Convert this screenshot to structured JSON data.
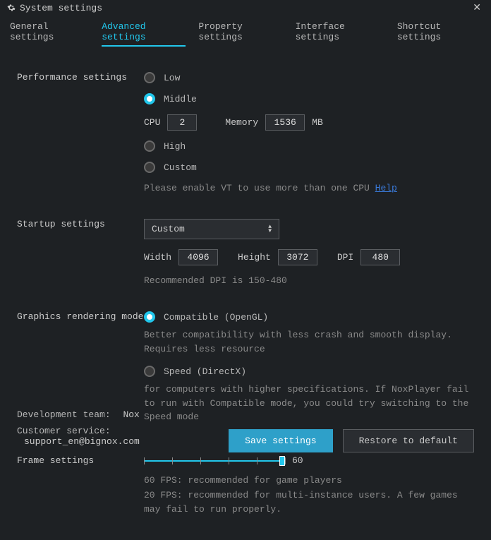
{
  "titlebar": {
    "title": "System settings"
  },
  "tabs": {
    "general": "General settings",
    "advanced": "Advanced settings",
    "property": "Property settings",
    "interface": "Interface settings",
    "shortcut": "Shortcut settings"
  },
  "perf": {
    "label": "Performance settings",
    "low": "Low",
    "middle": "Middle",
    "high": "High",
    "custom": "Custom",
    "cpu_label": "CPU",
    "cpu_value": "2",
    "mem_label": "Memory",
    "mem_value": "1536",
    "mem_unit": "MB",
    "vt_hint": "Please enable VT to use more than one CPU ",
    "vt_help": "Help"
  },
  "startup": {
    "label": "Startup settings",
    "select_value": "Custom",
    "width_label": "Width",
    "width_value": "4096",
    "height_label": "Height",
    "height_value": "3072",
    "dpi_label": "DPI",
    "dpi_value": "480",
    "dpi_hint": "Recommended DPI is 150-480"
  },
  "graphics": {
    "label": "Graphics rendering mode",
    "opt1": "Compatible (OpenGL)",
    "opt1_desc": "Better compatibility with less crash and smooth display. Requires less resource",
    "opt2": "Speed (DirectX)",
    "opt2_desc": "for computers with higher specifications. If NoxPlayer fail to run with Compatible mode, you could try switching to the Speed mode"
  },
  "frame": {
    "label": "Frame settings",
    "value": "60",
    "desc1": "60 FPS: recommended for game players",
    "desc2": "20 FPS: recommended for multi-instance users. A few games may fail to run properly."
  },
  "footer": {
    "dev_k": "Development team:",
    "dev_v": "Nox",
    "cust_k": "Customer service:",
    "cust_v": "support_en@bignox.com",
    "save": "Save settings",
    "restore": "Restore to default"
  }
}
